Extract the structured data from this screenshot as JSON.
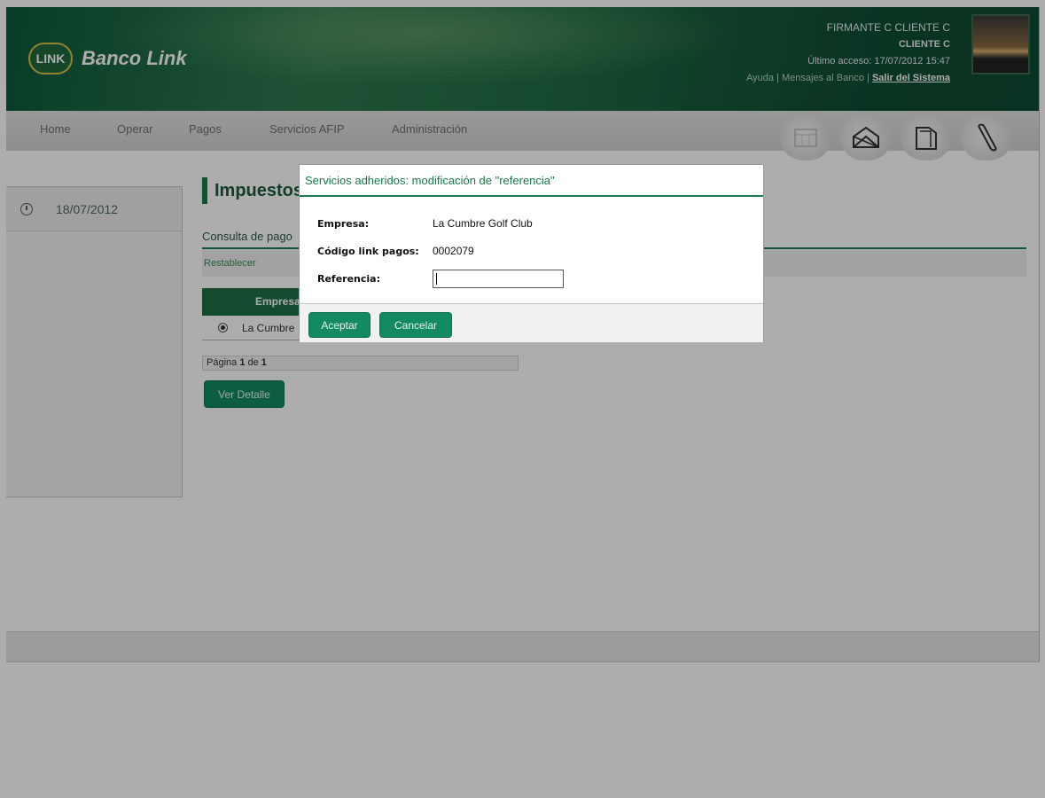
{
  "header": {
    "bank_name": "Banco Link",
    "logo_text": "LINK",
    "user_name": "FIRMANTE C CLIENTE C",
    "client_name": "CLIENTE C",
    "last_access": "Último acceso: 17/07/2012 15:47",
    "links": {
      "help": "Ayuda",
      "separator": " | ",
      "messages": "Mensajes al Banco",
      "logout": "Salir del Sistema"
    }
  },
  "nav": {
    "items": [
      "Home",
      "Operar",
      "Pagos",
      "Servicios AFIP",
      "Administración"
    ],
    "icons": [
      "calendar-icon",
      "envelope-icon",
      "folder-icon",
      "paperclip-icon"
    ]
  },
  "sidebar": {
    "date": "18/07/2012"
  },
  "main": {
    "title": "Impuestos",
    "subtitle": "Consulta de pago",
    "reset_label": "Restablecer",
    "table": {
      "header": "Empresa",
      "rows": [
        "La Cumbre"
      ]
    },
    "pager": {
      "prefix": "Página ",
      "current": "1",
      "middle": " de ",
      "total": "1"
    },
    "detail_button": "Ver Detalle"
  },
  "modal": {
    "title": "Servicios adheridos: modificación de \"referencia\"",
    "fields": {
      "empresa_label": "Empresa:",
      "empresa_value": "La Cumbre Golf Club",
      "codigo_label": "Código link pagos:",
      "codigo_value": "0002079",
      "referencia_label": "Referencia:",
      "referencia_value": ""
    },
    "accept_button": "Aceptar",
    "cancel_button": "Cancelar"
  },
  "colors": {
    "brand_green": "#1a7a4a",
    "button_green": "#148a63",
    "header_dark": "#0f5a3b"
  }
}
